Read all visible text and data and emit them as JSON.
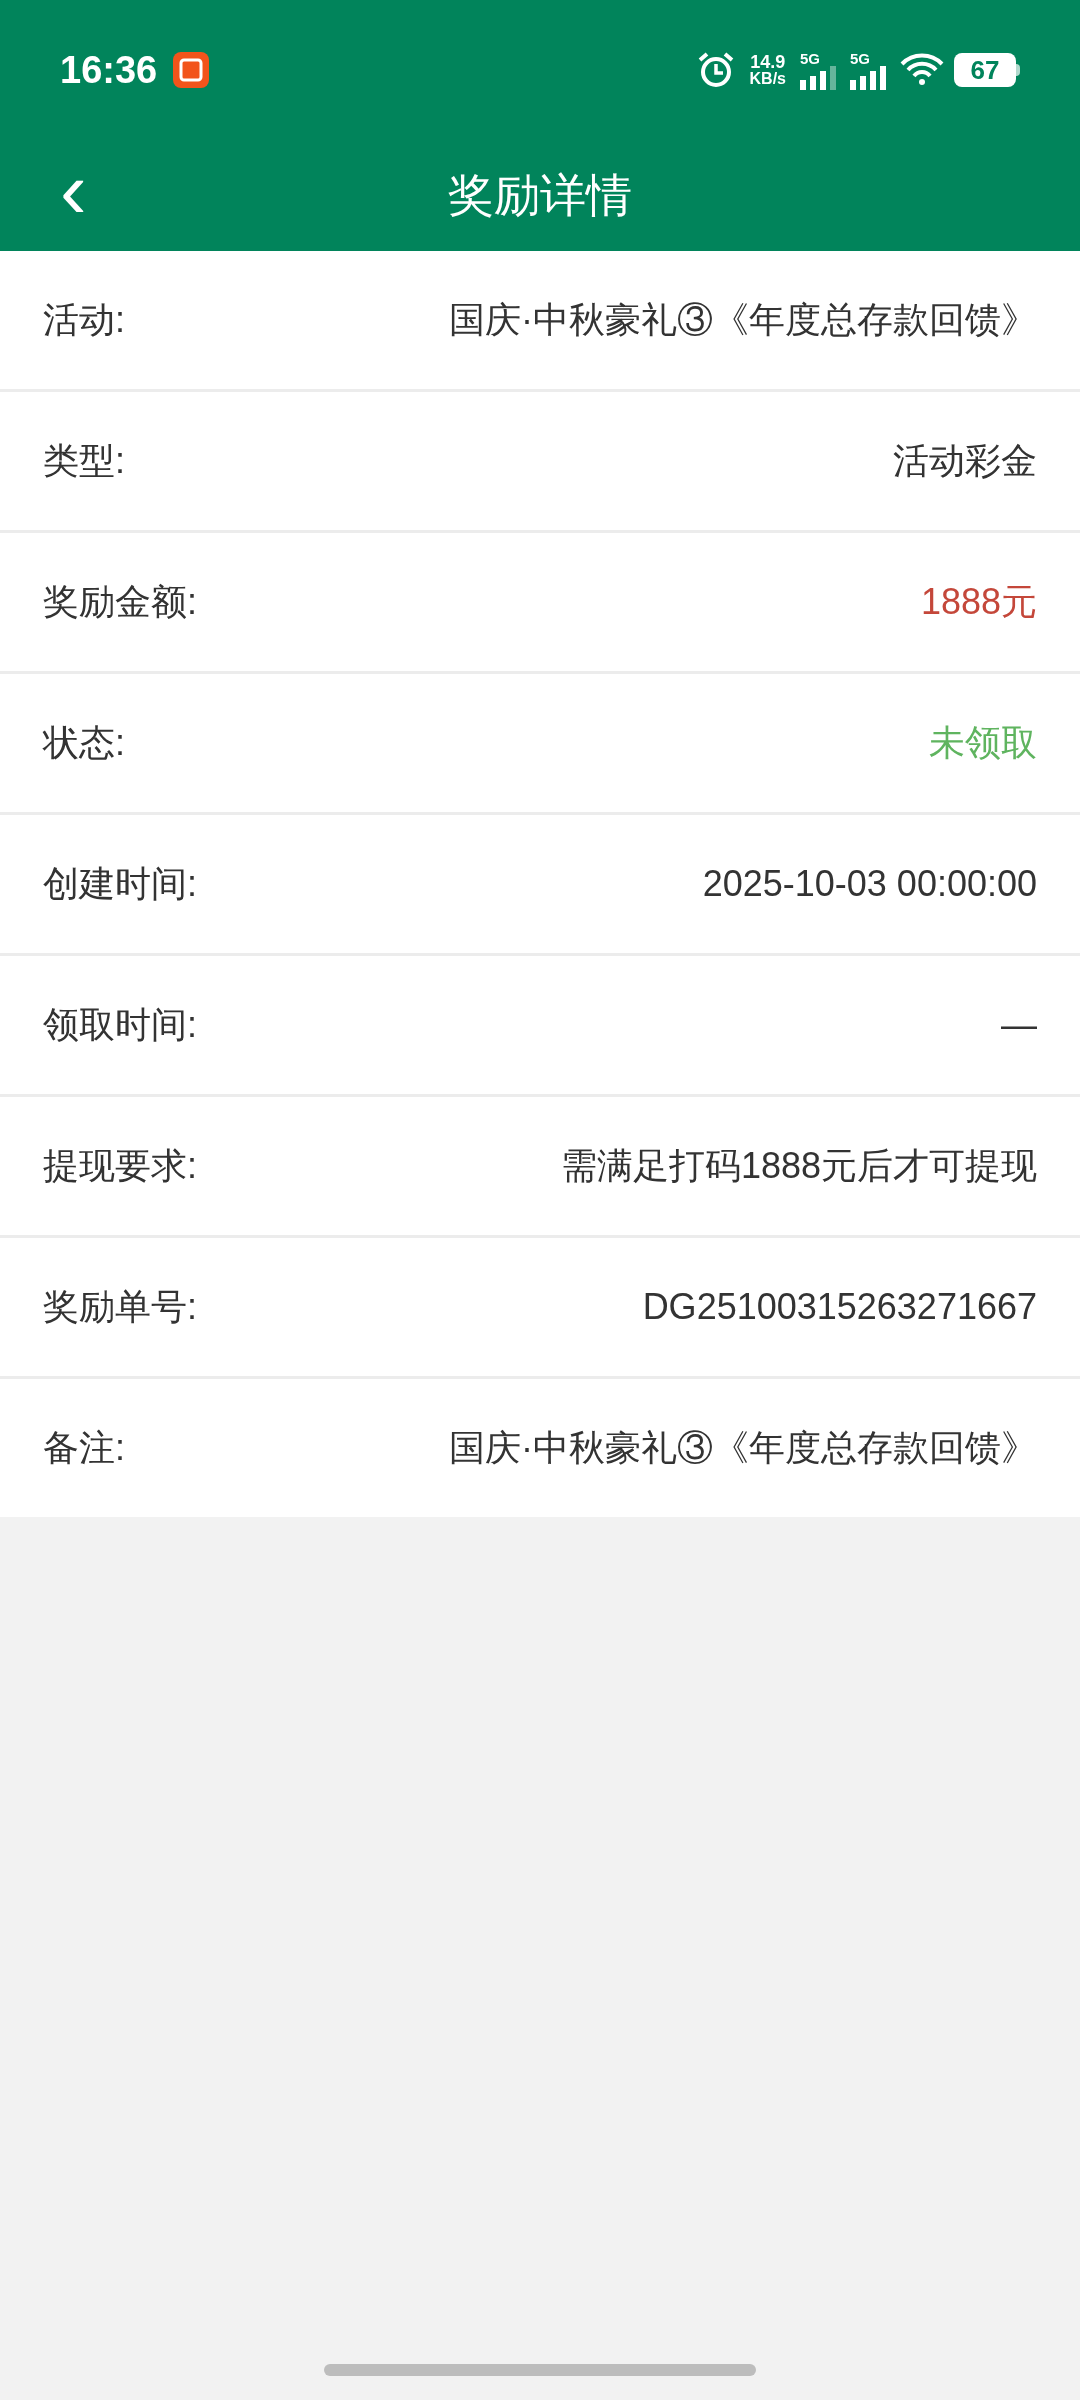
{
  "status_bar": {
    "time": "16:36",
    "net_speed_value": "14.9",
    "net_speed_unit": "KB/s",
    "signal_1_label": "5G",
    "signal_2_label": "5G",
    "battery": "67"
  },
  "header": {
    "back": "‹",
    "title": "奖励详情"
  },
  "rows": [
    {
      "label": "活动:",
      "value": "国庆·中秋豪礼③《年度总存款回馈》",
      "color": "#333333"
    },
    {
      "label": "类型:",
      "value": "活动彩金",
      "color": "#333333"
    },
    {
      "label": "奖励金额:",
      "value": "1888元",
      "color": "#c4473a"
    },
    {
      "label": "状态:",
      "value": "未领取",
      "color": "#5fb45f"
    },
    {
      "label": "创建时间:",
      "value": "2025-10-03 00:00:00",
      "color": "#333333"
    },
    {
      "label": "领取时间:",
      "value": "—",
      "color": "#333333"
    },
    {
      "label": "提现要求:",
      "value": "需满足打码1888元后才可提现",
      "color": "#333333"
    },
    {
      "label": "奖励单号:",
      "value": "DG25100315263271667",
      "color": "#333333"
    },
    {
      "label": "备注:",
      "value": "国庆·中秋豪礼③《年度总存款回馈》",
      "color": "#333333"
    }
  ]
}
